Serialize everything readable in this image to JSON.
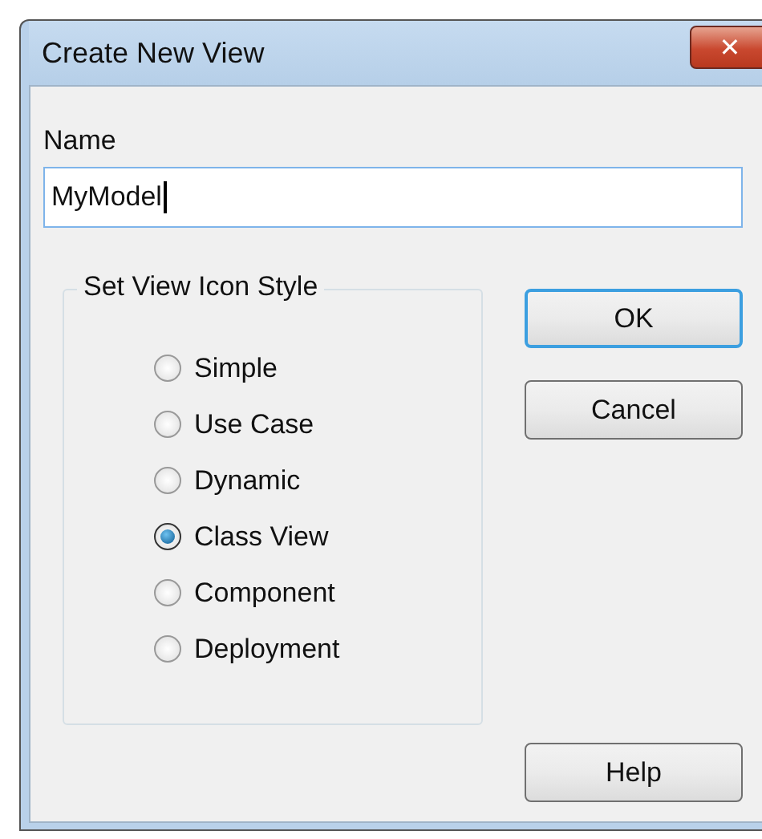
{
  "window": {
    "title": "Create New View",
    "close": "✕"
  },
  "name_field": {
    "label": "Name",
    "value": "MyModel"
  },
  "icon_style": {
    "title": "Set View Icon Style",
    "options": [
      {
        "label": "Simple",
        "selected": false
      },
      {
        "label": "Use Case",
        "selected": false
      },
      {
        "label": "Dynamic",
        "selected": false
      },
      {
        "label": "Class View",
        "selected": true
      },
      {
        "label": "Component",
        "selected": false
      },
      {
        "label": "Deployment",
        "selected": false
      }
    ]
  },
  "buttons": [
    {
      "label": "OK",
      "kind": "default"
    },
    {
      "label": "Cancel",
      "kind": "normal"
    },
    {
      "label": "Help",
      "kind": "help"
    }
  ]
}
